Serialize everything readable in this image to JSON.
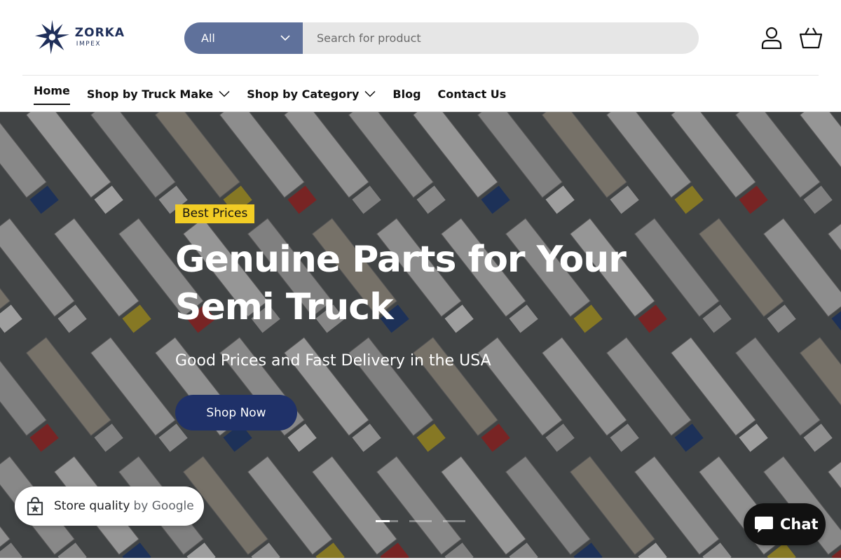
{
  "brand": {
    "name": "ZORKA",
    "sub": "IMPEX",
    "logo_icon": "star-icon",
    "color": "#1f2f5a"
  },
  "search": {
    "category": "All",
    "placeholder": "Search for product",
    "value": ""
  },
  "header_icons": {
    "account": "user-icon",
    "cart": "basket-icon"
  },
  "nav": {
    "items": [
      {
        "label": "Home",
        "has_dropdown": false,
        "active": true
      },
      {
        "label": "Shop by Truck Make",
        "has_dropdown": true
      },
      {
        "label": "Shop by Category",
        "has_dropdown": true
      },
      {
        "label": "Blog",
        "has_dropdown": false
      },
      {
        "label": "Contact Us",
        "has_dropdown": false
      }
    ]
  },
  "hero": {
    "badge": "Best Prices",
    "title": "Genuine Parts for Your Semi Truck",
    "subtitle": "Good Prices and Fast Delivery in the USA",
    "cta": "Shop Now",
    "slides": 3,
    "active_slide": 1
  },
  "google_badge": {
    "text": "Store quality",
    "by": "by Google",
    "icon": "shopping-bag-icon"
  },
  "chat": {
    "label": "Chat",
    "icon": "chat-bubble-icon"
  },
  "colors": {
    "search_category_bg": "#5f719b",
    "search_bg": "#e6e6e6",
    "badge_bg": "#f2cd25",
    "cta_bg": "#1f3169",
    "chat_bg": "#111111"
  }
}
